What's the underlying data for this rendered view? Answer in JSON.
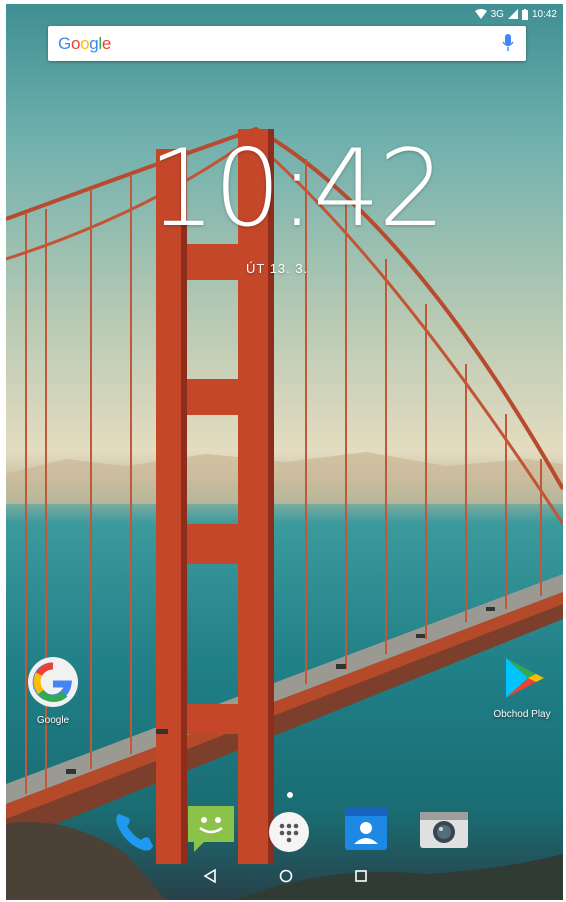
{
  "status_bar": {
    "network": "3G",
    "time": "10:42",
    "icons": [
      "wifi-icon",
      "signal-icon",
      "battery-icon"
    ]
  },
  "search_bar": {
    "logo": "Google",
    "icon": "mic-icon"
  },
  "clock_widget": {
    "time": "10:42",
    "date": "ÚT 13. 3."
  },
  "home_apps": [
    {
      "label": "Google",
      "icon": "google-app-icon"
    },
    {
      "label": "Obchod Play",
      "icon": "play-store-icon"
    }
  ],
  "dock": [
    "phone-icon",
    "messages-icon",
    "all-apps-icon",
    "contacts-icon",
    "camera-icon"
  ],
  "nav_bar": [
    "back-icon",
    "home-icon",
    "recents-icon"
  ],
  "colors": {
    "google_blue": "#4285F4",
    "google_red": "#EA4335",
    "google_yellow": "#FBBC05",
    "google_green": "#34A853",
    "bridge": "#c4472a"
  }
}
